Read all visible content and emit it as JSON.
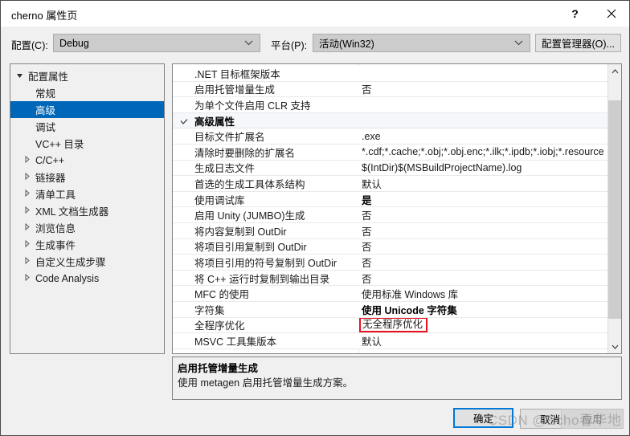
{
  "window": {
    "title": "cherno 属性页",
    "help_icon": "question-mark-icon",
    "close_icon": "close-icon"
  },
  "configbar": {
    "configuration_label": "配置(C):",
    "configuration_value": "Debug",
    "platform_label": "平台(P):",
    "platform_value": "活动(Win32)",
    "config_manager_button": "配置管理器(O)..."
  },
  "tree": {
    "items": [
      {
        "label": "配置属性",
        "level": "root",
        "state": "expanded",
        "selected": false
      },
      {
        "label": "常规",
        "level": "child",
        "state": "leaf",
        "selected": false
      },
      {
        "label": "高级",
        "level": "child",
        "state": "leaf",
        "selected": true
      },
      {
        "label": "调试",
        "level": "child",
        "state": "leaf",
        "selected": false
      },
      {
        "label": "VC++ 目录",
        "level": "child",
        "state": "leaf",
        "selected": false
      },
      {
        "label": "C/C++",
        "level": "expandable",
        "state": "collapsed",
        "selected": false
      },
      {
        "label": "链接器",
        "level": "expandable",
        "state": "collapsed",
        "selected": false
      },
      {
        "label": "清单工具",
        "level": "expandable",
        "state": "collapsed",
        "selected": false
      },
      {
        "label": "XML 文档生成器",
        "level": "expandable",
        "state": "collapsed",
        "selected": false
      },
      {
        "label": "浏览信息",
        "level": "expandable",
        "state": "collapsed",
        "selected": false
      },
      {
        "label": "生成事件",
        "level": "expandable",
        "state": "collapsed",
        "selected": false
      },
      {
        "label": "自定义生成步骤",
        "level": "expandable",
        "state": "collapsed",
        "selected": false
      },
      {
        "label": "Code Analysis",
        "level": "expandable",
        "state": "collapsed",
        "selected": false
      }
    ]
  },
  "grid": {
    "rows": [
      {
        "name": ".NET 目标框架版本",
        "value": "",
        "group": false,
        "bold": false,
        "highlight": false
      },
      {
        "name": "启用托管增量生成",
        "value": "否",
        "group": false,
        "bold": false,
        "highlight": false
      },
      {
        "name": "为单个文件启用 CLR 支持",
        "value": "",
        "group": false,
        "bold": false,
        "highlight": false
      },
      {
        "name": "高级属性",
        "value": "",
        "group": true,
        "bold": true,
        "highlight": false
      },
      {
        "name": "目标文件扩展名",
        "value": ".exe",
        "group": false,
        "bold": false,
        "highlight": false
      },
      {
        "name": "清除时要删除的扩展名",
        "value": "*.cdf;*.cache;*.obj;*.obj.enc;*.ilk;*.ipdb;*.iobj;*.resource",
        "group": false,
        "bold": false,
        "highlight": false
      },
      {
        "name": "生成日志文件",
        "value": "$(IntDir)$(MSBuildProjectName).log",
        "group": false,
        "bold": false,
        "highlight": false
      },
      {
        "name": "首选的生成工具体系结构",
        "value": "默认",
        "group": false,
        "bold": false,
        "highlight": false
      },
      {
        "name": "使用调试库",
        "value": "是",
        "group": false,
        "bold": true,
        "highlight": false
      },
      {
        "name": "启用 Unity (JUMBO)生成",
        "value": "否",
        "group": false,
        "bold": false,
        "highlight": false
      },
      {
        "name": "将内容复制到 OutDir",
        "value": "否",
        "group": false,
        "bold": false,
        "highlight": false
      },
      {
        "name": "将项目引用复制到 OutDir",
        "value": "否",
        "group": false,
        "bold": false,
        "highlight": false
      },
      {
        "name": "将项目引用的符号复制到 OutDir",
        "value": "否",
        "group": false,
        "bold": false,
        "highlight": false
      },
      {
        "name": "将 C++ 运行时复制到输出目录",
        "value": "否",
        "group": false,
        "bold": false,
        "highlight": false
      },
      {
        "name": "MFC 的使用",
        "value": "使用标准 Windows 库",
        "group": false,
        "bold": false,
        "highlight": false
      },
      {
        "name": "字符集",
        "value": "使用 Unicode 字符集",
        "group": false,
        "bold": true,
        "highlight": false
      },
      {
        "name": "全程序优化",
        "value": "无全程序优化",
        "group": false,
        "bold": false,
        "highlight": true
      },
      {
        "name": "MSVC 工具集版本",
        "value": "默认",
        "group": false,
        "bold": false,
        "highlight": false
      }
    ],
    "highlight_color": "#e81123",
    "scroll_up_icon": "chevron-up-icon",
    "scroll_down_icon": "chevron-down-icon"
  },
  "description": {
    "title": "启用托管增量生成",
    "body": "使用 metagen 启用托管增量生成方案。"
  },
  "footer": {
    "ok_label": "确定",
    "cancel_label": "取消",
    "apply_label": "应用",
    "accent_color": "#0078d7"
  },
  "watermark": {
    "text": "CSDN @Echo春华地"
  }
}
